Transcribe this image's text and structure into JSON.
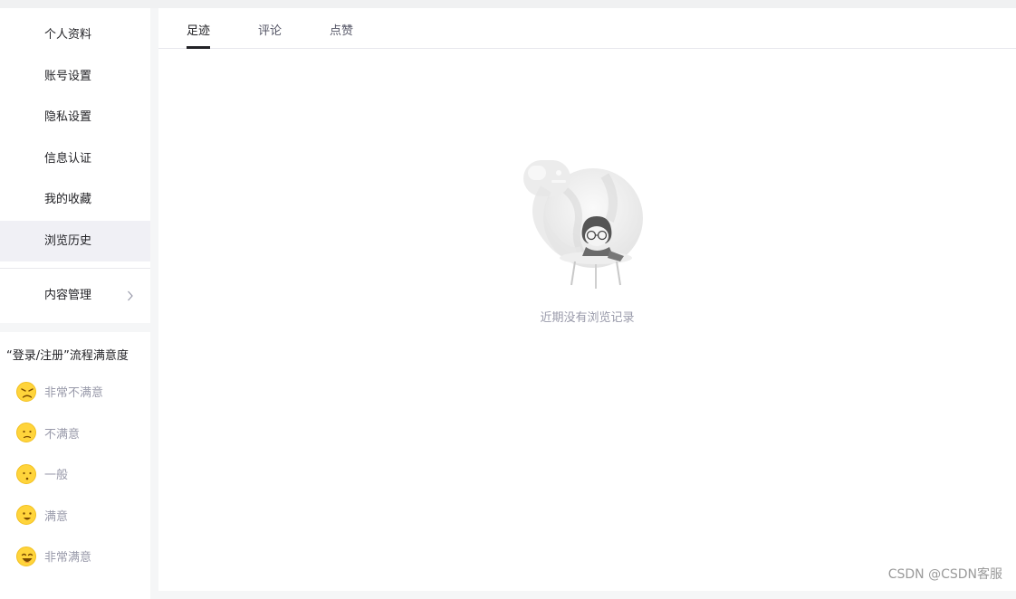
{
  "sidebar": {
    "items": [
      {
        "label": "个人资料"
      },
      {
        "label": "账号设置"
      },
      {
        "label": "隐私设置"
      },
      {
        "label": "信息认证"
      },
      {
        "label": "我的收藏"
      },
      {
        "label": "浏览历史"
      }
    ],
    "content_manage": {
      "label": "内容管理",
      "icon": "chevron-right-icon"
    }
  },
  "survey": {
    "title": "“登录/注册”流程满意度",
    "options": [
      {
        "label": "非常不满意",
        "icon": "angry-face-icon"
      },
      {
        "label": "不满意",
        "icon": "frown-face-icon"
      },
      {
        "label": "一般",
        "icon": "neutral-face-icon"
      },
      {
        "label": "满意",
        "icon": "smile-face-icon"
      },
      {
        "label": "非常满意",
        "icon": "grin-face-icon"
      }
    ]
  },
  "main": {
    "tabs": [
      {
        "label": "足迹"
      },
      {
        "label": "评论"
      },
      {
        "label": "点赞"
      }
    ],
    "empty_text": "近期没有浏览记录"
  },
  "watermark": "CSDN @CSDN客服",
  "colors": {
    "accent_emoji": "#ffd43b",
    "text_primary": "#222226",
    "text_muted": "#999aaa"
  }
}
